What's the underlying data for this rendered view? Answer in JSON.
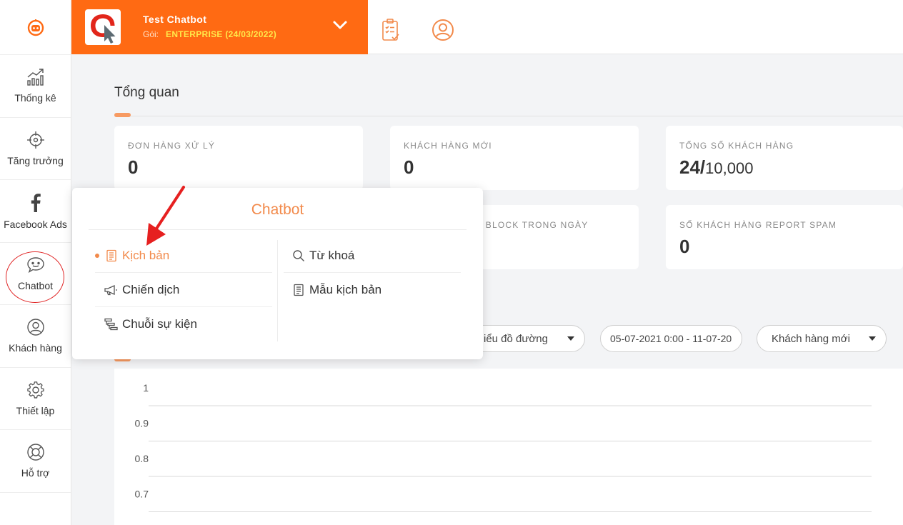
{
  "sidebar": {
    "items": [
      {
        "label": "Thống kê",
        "icon": "chart-icon"
      },
      {
        "label": "Tăng trưởng",
        "icon": "crosshair-icon"
      },
      {
        "label": "Facebook Ads",
        "icon": "facebook-icon"
      },
      {
        "label": "Chatbot",
        "icon": "chat-bubble-icon"
      },
      {
        "label": "Khách hàng",
        "icon": "user-circle-icon"
      },
      {
        "label": "Thiết lập",
        "icon": "gear-icon"
      },
      {
        "label": "Hỗ trợ",
        "icon": "lifebuoy-icon"
      }
    ]
  },
  "header": {
    "bot_name": "Test Chatbot",
    "plan_label": "Gói:",
    "plan_value": "ENTERPRISE (24/03/2022)"
  },
  "main": {
    "title": "Tổng quan",
    "cards": [
      {
        "label": "ĐƠN HÀNG XỬ LÝ",
        "value": "0"
      },
      {
        "label": "KHÁCH HÀNG MỚI",
        "value": "0"
      },
      {
        "label": "TỔNG SỐ KHÁCH HÀNG",
        "value": "24/",
        "total": "10,000"
      },
      {
        "label": "S BLOCK TRONG NGÀY",
        "value": ""
      },
      {
        "label": "SỐ KHÁCH HÀNG REPORT SPAM",
        "value": "0"
      }
    ],
    "filters": {
      "chart_type": "iểu đồ đường",
      "date_range": "05-07-2021 0:00 - 11-07-20",
      "metric": "Khách hàng mới"
    }
  },
  "chart_data": {
    "type": "line",
    "y_ticks": [
      "1",
      "0.9",
      "0.8",
      "0.7"
    ],
    "ylim": [
      0.7,
      1
    ],
    "series": []
  },
  "popup": {
    "title": "Chatbot",
    "left_items": [
      "Kịch bản",
      "Chiến dịch",
      "Chuỗi sự kiện"
    ],
    "right_items": [
      "Từ khoá",
      "Mẫu kịch bản"
    ],
    "active": "Kịch bản"
  },
  "colors": {
    "brand": "#ff6a13",
    "accent": "#f28a4b",
    "plan": "#ffe94a",
    "highlight": "#e02424"
  }
}
